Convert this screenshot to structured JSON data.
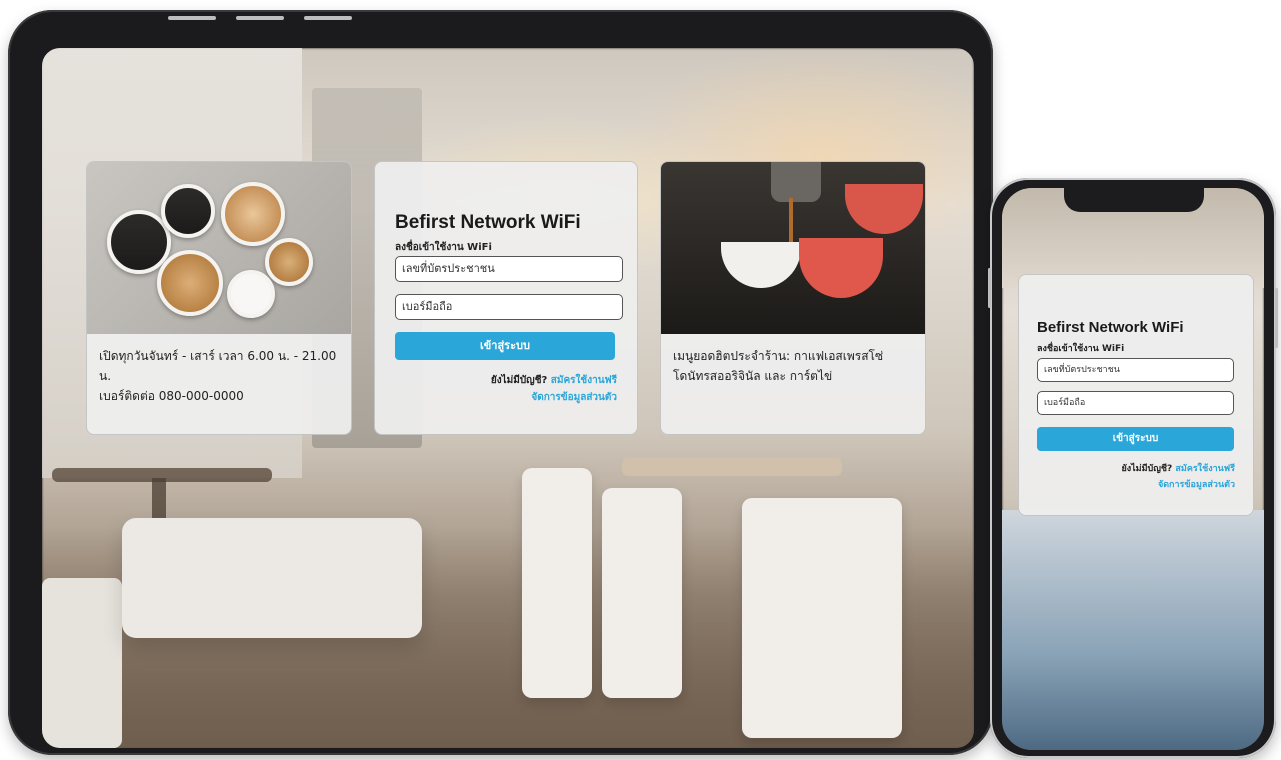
{
  "brand_color": "#2aa6d9",
  "tablet": {
    "card_left": {
      "lines": [
        "เปิดทุกวันจันทร์ - เสาร์ เวลา 6.00 น. - 21.00 น.",
        "เบอร์ติดต่อ 080-000-0000"
      ]
    },
    "login": {
      "title": "Befirst Network WiFi",
      "subtitle": "ลงชื่อเข้าใช้งาน WiFi",
      "id_placeholder": "เลขที่บัตรประชาชน",
      "phone_placeholder": "เบอร์มือถือ",
      "submit_label": "เข้าสู่ระบบ",
      "no_account": "ยังไม่มีบัญชี?",
      "register_link": "สมัครใช้งานฟรี",
      "profile_link": "จัดการข้อมูลส่วนตัว"
    },
    "card_right": {
      "lines": [
        "เมนูยอดฮิตประจำร้าน: กาแฟเอสเพรสโซ่",
        "โดนัทรสออริจินัล และ การ์ตไข่"
      ]
    }
  },
  "phone": {
    "login": {
      "title": "Befirst Network WiFi",
      "subtitle": "ลงชื่อเข้าใช้งาน WiFi",
      "id_placeholder": "เลขที่บัตรประชาชน",
      "phone_placeholder": "เบอร์มือถือ",
      "submit_label": "เข้าสู่ระบบ",
      "no_account": "ยังไม่มีบัญชี?",
      "register_link": "สมัครใช้งานฟรี",
      "profile_link": "จัดการข้อมูลส่วนตัว"
    }
  }
}
